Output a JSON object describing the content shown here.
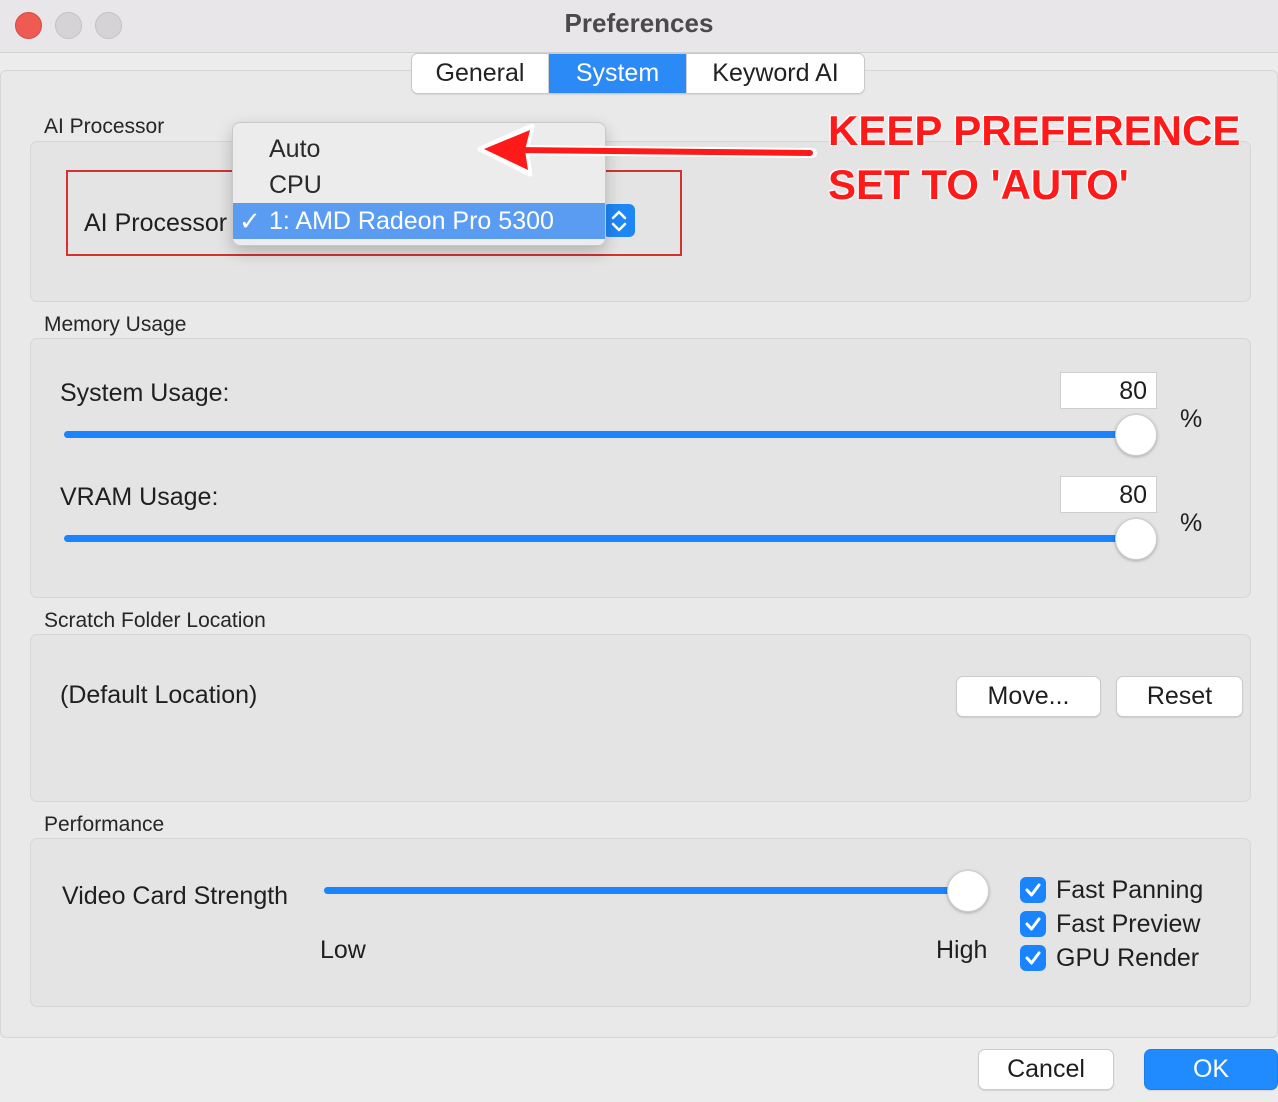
{
  "window": {
    "title": "Preferences"
  },
  "tabs": [
    {
      "label": "General"
    },
    {
      "label": "System"
    },
    {
      "label": "Keyword AI"
    }
  ],
  "ai_processor": {
    "section_label": "AI Processor",
    "field_label": "AI Processor",
    "options": [
      "Auto",
      "CPU",
      "1: AMD Radeon Pro 5300"
    ],
    "selected": "1: AMD Radeon Pro 5300"
  },
  "annotation": {
    "line1": "KEEP PREFERENCE",
    "line2": "SET TO 'AUTO'",
    "color": "#ff1a1a"
  },
  "memory": {
    "section_label": "Memory Usage",
    "system_label": "System Usage:",
    "system_value": "80",
    "vram_label": "VRAM Usage:",
    "vram_value": "80",
    "unit": "%"
  },
  "scratch": {
    "section_label": "Scratch Folder Location",
    "location": "(Default Location)",
    "move_label": "Move...",
    "reset_label": "Reset"
  },
  "performance": {
    "section_label": "Performance",
    "strength_label": "Video Card Strength",
    "low_label": "Low",
    "high_label": "High",
    "strength_level": 1.0,
    "checkboxes": [
      {
        "label": "Fast Panning",
        "checked": true
      },
      {
        "label": "Fast Preview",
        "checked": true
      },
      {
        "label": "GPU Render",
        "checked": true
      }
    ]
  },
  "footer": {
    "cancel_label": "Cancel",
    "ok_label": "OK"
  },
  "colors": {
    "accent": "#1a84ff",
    "highlight_box": "#d33232"
  }
}
